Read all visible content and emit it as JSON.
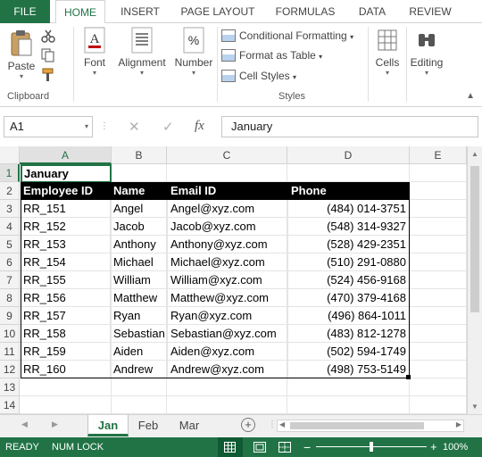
{
  "ribbon_tabs": [
    "FILE",
    "HOME",
    "INSERT",
    "PAGE LAYOUT",
    "FORMULAS",
    "DATA",
    "REVIEW"
  ],
  "ribbon": {
    "paste": "Paste",
    "clipboard": "Clipboard",
    "font": "Font",
    "alignment": "Alignment",
    "number": "Number",
    "conditional_formatting": "Conditional Formatting",
    "format_as_table": "Format as Table",
    "cell_styles": "Cell Styles",
    "styles": "Styles",
    "cells": "Cells",
    "editing": "Editing"
  },
  "formula_bar": {
    "name_box": "A1",
    "fx": "fx",
    "value": "January"
  },
  "columns": [
    "A",
    "B",
    "C",
    "D",
    "E"
  ],
  "rows": [
    "1",
    "2",
    "3",
    "4",
    "5",
    "6",
    "7",
    "8",
    "9",
    "10",
    "11",
    "12",
    "13",
    "14"
  ],
  "sheet": {
    "title": "January",
    "headers": [
      "Employee ID",
      "Name",
      "Email ID",
      "Phone"
    ],
    "records": [
      [
        "RR_151",
        "Angel",
        "Angel@xyz.com",
        "(484) 014-3751"
      ],
      [
        "RR_152",
        "Jacob",
        "Jacob@xyz.com",
        "(548) 314-9327"
      ],
      [
        "RR_153",
        "Anthony",
        "Anthony@xyz.com",
        "(528) 429-2351"
      ],
      [
        "RR_154",
        "Michael",
        "Michael@xyz.com",
        "(510) 291-0880"
      ],
      [
        "RR_155",
        "William",
        "William@xyz.com",
        "(524) 456-9168"
      ],
      [
        "RR_156",
        "Matthew",
        "Matthew@xyz.com",
        "(470) 379-4168"
      ],
      [
        "RR_157",
        "Ryan",
        "Ryan@xyz.com",
        "(496) 864-1011"
      ],
      [
        "RR_158",
        "Sebastian",
        "Sebastian@xyz.com",
        "(483) 812-1278"
      ],
      [
        "RR_159",
        "Aiden",
        "Aiden@xyz.com",
        "(502) 594-1749"
      ],
      [
        "RR_160",
        "Andrew",
        "Andrew@xyz.com",
        "(498) 753-5149"
      ]
    ]
  },
  "sheet_tabs": [
    "Jan",
    "Feb",
    "Mar"
  ],
  "status": {
    "ready": "READY",
    "num_lock": "NUM LOCK",
    "zoom": "100%"
  },
  "colors": {
    "accent": "#217346"
  }
}
